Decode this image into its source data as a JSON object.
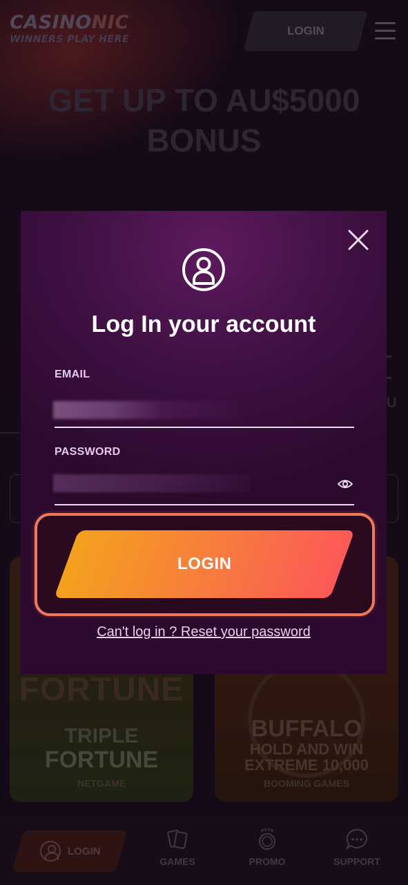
{
  "header": {
    "logo_main_a": "CASINO",
    "logo_main_b": "NIC",
    "logo_tagline": "WINNERS PLAY HERE",
    "login_label": "LOGIN"
  },
  "hero": {
    "line1": "GET UP TO AU$5000",
    "line2": "BONUS"
  },
  "side": {
    "right_letter": "U"
  },
  "games": [
    {
      "art_word": "FORTUNE",
      "title_line1": "TRIPLE",
      "title_line2": "FORTUNE",
      "provider": "NETGAME"
    },
    {
      "title_line1": "BUFFALO",
      "title_line2": "HOLD AND WIN",
      "title_line3": "EXTREME 10,000",
      "provider": "BOOMING GAMES"
    }
  ],
  "bottom_nav": {
    "login": "LOGIN",
    "games": "GAMES",
    "promo": "PROMO",
    "support": "SUPPORT"
  },
  "modal": {
    "title": "Log In your account",
    "email_label": "EMAIL",
    "email_value": "",
    "password_label": "PASSWORD",
    "password_value": "",
    "login_button": "LOGIN",
    "reset_link": "Can't log in ? Reset your password"
  },
  "colors": {
    "modal_top": "#5d1a5e",
    "modal_bottom": "#2b0a2d",
    "button_start": "#f4a11e",
    "button_end": "#fc5958",
    "highlight_border": "#f2785a"
  }
}
